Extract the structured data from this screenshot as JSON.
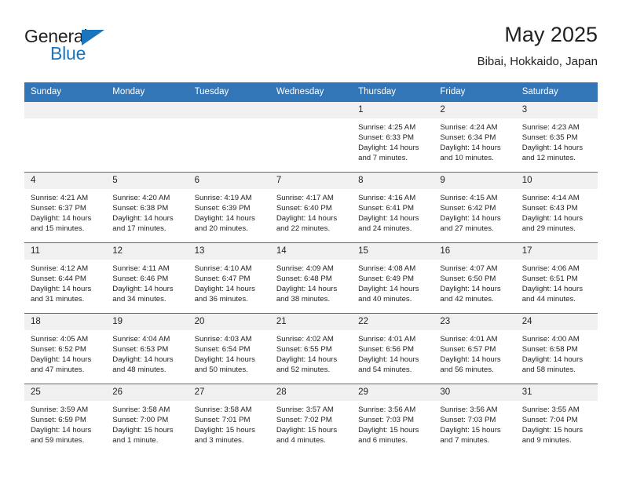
{
  "brand": {
    "name_top": "General",
    "name_bottom": "Blue",
    "triangle_icon": "triangle-icon",
    "accent_color": "#1b75bc"
  },
  "header": {
    "title": "May 2025",
    "subtitle": "Bibai, Hokkaido, Japan"
  },
  "colors": {
    "header_blue": "#3276b8",
    "day_band": "#f0f0f0",
    "text": "#231f20"
  },
  "weekday_headers": [
    "Sunday",
    "Monday",
    "Tuesday",
    "Wednesday",
    "Thursday",
    "Friday",
    "Saturday"
  ],
  "labels": {
    "sunrise_prefix": "Sunrise:",
    "sunset_prefix": "Sunset:",
    "daylight_prefix": "Daylight:"
  },
  "weeks": [
    [
      {
        "blank": true
      },
      {
        "blank": true
      },
      {
        "blank": true
      },
      {
        "blank": true
      },
      {
        "day": "1",
        "sunrise": "Sunrise: 4:25 AM",
        "sunset": "Sunset: 6:33 PM",
        "daylight": "Daylight: 14 hours and 7 minutes."
      },
      {
        "day": "2",
        "sunrise": "Sunrise: 4:24 AM",
        "sunset": "Sunset: 6:34 PM",
        "daylight": "Daylight: 14 hours and 10 minutes."
      },
      {
        "day": "3",
        "sunrise": "Sunrise: 4:23 AM",
        "sunset": "Sunset: 6:35 PM",
        "daylight": "Daylight: 14 hours and 12 minutes."
      }
    ],
    [
      {
        "day": "4",
        "sunrise": "Sunrise: 4:21 AM",
        "sunset": "Sunset: 6:37 PM",
        "daylight": "Daylight: 14 hours and 15 minutes."
      },
      {
        "day": "5",
        "sunrise": "Sunrise: 4:20 AM",
        "sunset": "Sunset: 6:38 PM",
        "daylight": "Daylight: 14 hours and 17 minutes."
      },
      {
        "day": "6",
        "sunrise": "Sunrise: 4:19 AM",
        "sunset": "Sunset: 6:39 PM",
        "daylight": "Daylight: 14 hours and 20 minutes."
      },
      {
        "day": "7",
        "sunrise": "Sunrise: 4:17 AM",
        "sunset": "Sunset: 6:40 PM",
        "daylight": "Daylight: 14 hours and 22 minutes."
      },
      {
        "day": "8",
        "sunrise": "Sunrise: 4:16 AM",
        "sunset": "Sunset: 6:41 PM",
        "daylight": "Daylight: 14 hours and 24 minutes."
      },
      {
        "day": "9",
        "sunrise": "Sunrise: 4:15 AM",
        "sunset": "Sunset: 6:42 PM",
        "daylight": "Daylight: 14 hours and 27 minutes."
      },
      {
        "day": "10",
        "sunrise": "Sunrise: 4:14 AM",
        "sunset": "Sunset: 6:43 PM",
        "daylight": "Daylight: 14 hours and 29 minutes."
      }
    ],
    [
      {
        "day": "11",
        "sunrise": "Sunrise: 4:12 AM",
        "sunset": "Sunset: 6:44 PM",
        "daylight": "Daylight: 14 hours and 31 minutes."
      },
      {
        "day": "12",
        "sunrise": "Sunrise: 4:11 AM",
        "sunset": "Sunset: 6:46 PM",
        "daylight": "Daylight: 14 hours and 34 minutes."
      },
      {
        "day": "13",
        "sunrise": "Sunrise: 4:10 AM",
        "sunset": "Sunset: 6:47 PM",
        "daylight": "Daylight: 14 hours and 36 minutes."
      },
      {
        "day": "14",
        "sunrise": "Sunrise: 4:09 AM",
        "sunset": "Sunset: 6:48 PM",
        "daylight": "Daylight: 14 hours and 38 minutes."
      },
      {
        "day": "15",
        "sunrise": "Sunrise: 4:08 AM",
        "sunset": "Sunset: 6:49 PM",
        "daylight": "Daylight: 14 hours and 40 minutes."
      },
      {
        "day": "16",
        "sunrise": "Sunrise: 4:07 AM",
        "sunset": "Sunset: 6:50 PM",
        "daylight": "Daylight: 14 hours and 42 minutes."
      },
      {
        "day": "17",
        "sunrise": "Sunrise: 4:06 AM",
        "sunset": "Sunset: 6:51 PM",
        "daylight": "Daylight: 14 hours and 44 minutes."
      }
    ],
    [
      {
        "day": "18",
        "sunrise": "Sunrise: 4:05 AM",
        "sunset": "Sunset: 6:52 PM",
        "daylight": "Daylight: 14 hours and 47 minutes."
      },
      {
        "day": "19",
        "sunrise": "Sunrise: 4:04 AM",
        "sunset": "Sunset: 6:53 PM",
        "daylight": "Daylight: 14 hours and 48 minutes."
      },
      {
        "day": "20",
        "sunrise": "Sunrise: 4:03 AM",
        "sunset": "Sunset: 6:54 PM",
        "daylight": "Daylight: 14 hours and 50 minutes."
      },
      {
        "day": "21",
        "sunrise": "Sunrise: 4:02 AM",
        "sunset": "Sunset: 6:55 PM",
        "daylight": "Daylight: 14 hours and 52 minutes."
      },
      {
        "day": "22",
        "sunrise": "Sunrise: 4:01 AM",
        "sunset": "Sunset: 6:56 PM",
        "daylight": "Daylight: 14 hours and 54 minutes."
      },
      {
        "day": "23",
        "sunrise": "Sunrise: 4:01 AM",
        "sunset": "Sunset: 6:57 PM",
        "daylight": "Daylight: 14 hours and 56 minutes."
      },
      {
        "day": "24",
        "sunrise": "Sunrise: 4:00 AM",
        "sunset": "Sunset: 6:58 PM",
        "daylight": "Daylight: 14 hours and 58 minutes."
      }
    ],
    [
      {
        "day": "25",
        "sunrise": "Sunrise: 3:59 AM",
        "sunset": "Sunset: 6:59 PM",
        "daylight": "Daylight: 14 hours and 59 minutes."
      },
      {
        "day": "26",
        "sunrise": "Sunrise: 3:58 AM",
        "sunset": "Sunset: 7:00 PM",
        "daylight": "Daylight: 15 hours and 1 minute."
      },
      {
        "day": "27",
        "sunrise": "Sunrise: 3:58 AM",
        "sunset": "Sunset: 7:01 PM",
        "daylight": "Daylight: 15 hours and 3 minutes."
      },
      {
        "day": "28",
        "sunrise": "Sunrise: 3:57 AM",
        "sunset": "Sunset: 7:02 PM",
        "daylight": "Daylight: 15 hours and 4 minutes."
      },
      {
        "day": "29",
        "sunrise": "Sunrise: 3:56 AM",
        "sunset": "Sunset: 7:03 PM",
        "daylight": "Daylight: 15 hours and 6 minutes."
      },
      {
        "day": "30",
        "sunrise": "Sunrise: 3:56 AM",
        "sunset": "Sunset: 7:03 PM",
        "daylight": "Daylight: 15 hours and 7 minutes."
      },
      {
        "day": "31",
        "sunrise": "Sunrise: 3:55 AM",
        "sunset": "Sunset: 7:04 PM",
        "daylight": "Daylight: 15 hours and 9 minutes."
      }
    ]
  ]
}
